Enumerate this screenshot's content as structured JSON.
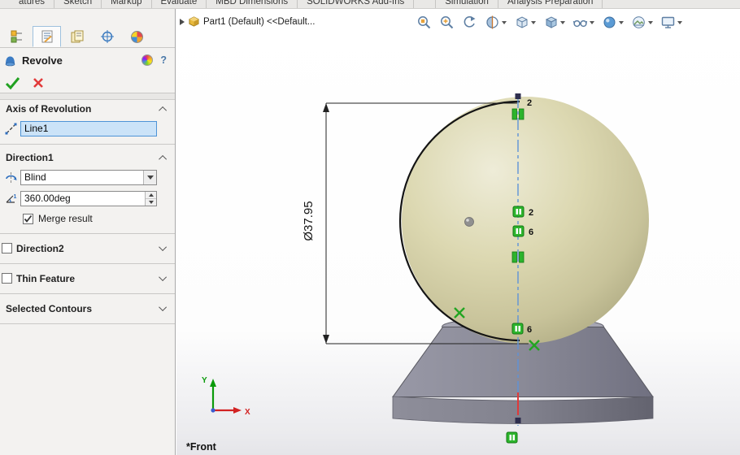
{
  "command_tabs": [
    "atures",
    "Sketch",
    "Markup",
    "Evaluate",
    "MBD Dimensions",
    "SOLIDWORKS Add-Ins",
    "Simulation",
    "Analysis Preparation"
  ],
  "breadcrumb": {
    "part_label": "Part1 (Default) <<Default..."
  },
  "panel": {
    "title": "Revolve",
    "help_label": "?",
    "axis_section": {
      "label": "Axis of Revolution",
      "axis_value": "Line1"
    },
    "direction1": {
      "label": "Direction1",
      "end_condition": "Blind",
      "angle_value": "360.00deg",
      "merge_checkbox_label": "Merge result"
    },
    "direction2": {
      "label": "Direction2"
    },
    "thin_feature": {
      "label": "Thin Feature"
    },
    "selected_contours": {
      "label": "Selected Contours"
    }
  },
  "viewport": {
    "dimension_label": "Ø37.95",
    "view_orientation_label": "*Front",
    "triad": {
      "x": "X",
      "y": "Y"
    },
    "relation_numbers": [
      "2",
      "2",
      "6",
      "6"
    ]
  },
  "colors": {
    "selection_blue": "#4e94d6",
    "relation_green": "#2cb42c",
    "sphere_beige": "#d9d5ae",
    "pedestal_gray": "#84848f",
    "centerline_blue": "#5e93d8"
  }
}
